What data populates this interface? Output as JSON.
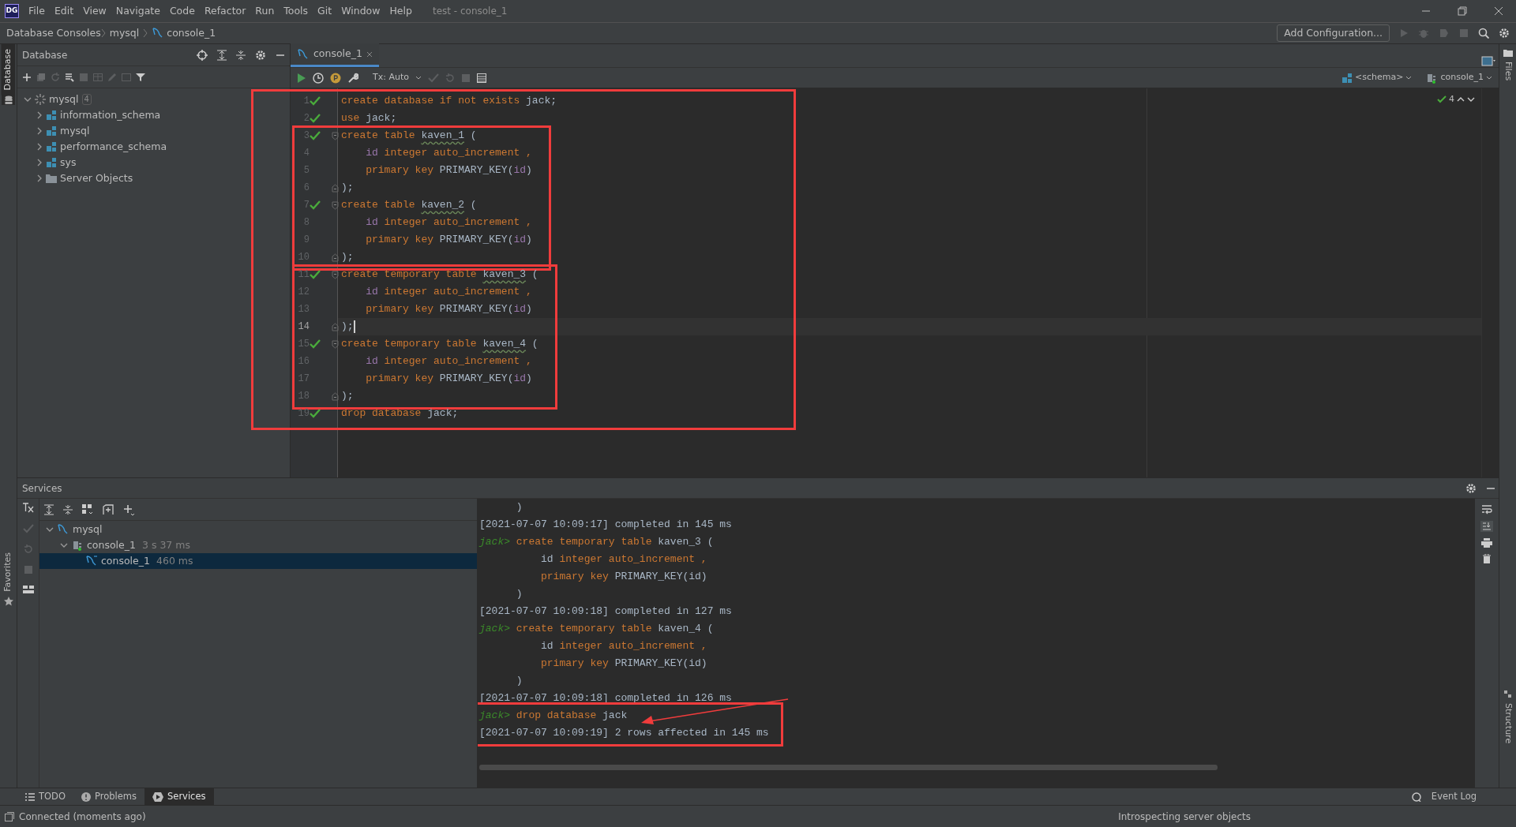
{
  "title_bar": {
    "logo": "DG",
    "menu": [
      "File",
      "Edit",
      "View",
      "Navigate",
      "Code",
      "Refactor",
      "Run",
      "Tools",
      "Git",
      "Window",
      "Help"
    ],
    "title": "test - console_1"
  },
  "nav_bar": {
    "breadcrumbs": [
      "Database Consoles",
      "mysql",
      "console_1"
    ],
    "run_config": "Add Configuration..."
  },
  "left_stripe": {
    "top_label": "Database",
    "bottom_label": "Favorites"
  },
  "right_stripe": {
    "top_label": "Files",
    "bottom_label": "Structure"
  },
  "database_panel": {
    "title": "Database",
    "tree": [
      {
        "label": "mysql",
        "badge": "4",
        "kind": "datasource",
        "expanded": true,
        "children": [
          {
            "label": "information_schema",
            "kind": "schema",
            "expanded": false
          },
          {
            "label": "mysql",
            "kind": "schema",
            "expanded": false
          },
          {
            "label": "performance_schema",
            "kind": "schema",
            "expanded": false
          },
          {
            "label": "sys",
            "kind": "schema",
            "expanded": false
          },
          {
            "label": "Server Objects",
            "kind": "folder",
            "expanded": false
          }
        ]
      }
    ]
  },
  "editor": {
    "tab": {
      "label": "console_1",
      "selected": true
    },
    "tx_mode": "Tx: Auto",
    "schema": "<schema>",
    "session": "console_1",
    "check_count": "4",
    "framed": true,
    "blocks": [
      {
        "framed": false,
        "lines": [
          {
            "number": "1",
            "check": true,
            "current": false,
            "tokens": [
              {
                "kind": "kw",
                "text": "create database if not exists"
              },
              {
                "kind": "plain",
                "text": " jack;"
              }
            ]
          },
          {
            "number": "2",
            "check": true,
            "current": false,
            "tokens": [
              {
                "kind": "kw",
                "text": "use"
              },
              {
                "kind": "plain",
                "text": " jack;"
              }
            ]
          }
        ]
      },
      {
        "framed": true,
        "lines": [
          {
            "number": "3",
            "check": true,
            "current": false,
            "fold": {
              "kind": "start"
            },
            "tokens": [
              {
                "kind": "kw",
                "text": "create table "
              },
              {
                "kind": "ident",
                "text": "kaven_1"
              },
              {
                "kind": "plain",
                "text": " ("
              }
            ]
          },
          {
            "number": "4",
            "check": false,
            "current": false,
            "tokens": [
              {
                "kind": "col",
                "text": "    id"
              },
              {
                "kind": "kw",
                "text": " integer auto_increment ,"
              }
            ]
          },
          {
            "number": "5",
            "check": false,
            "current": false,
            "tokens": [
              {
                "kind": "kw",
                "text": "    primary key"
              },
              {
                "kind": "plain",
                "text": " PRIMARY_KEY("
              },
              {
                "kind": "col",
                "text": "id"
              },
              {
                "kind": "plain",
                "text": ")"
              }
            ]
          },
          {
            "number": "6",
            "check": false,
            "current": false,
            "fold": {
              "kind": "end"
            },
            "tokens": [
              {
                "kind": "plain",
                "text": ");"
              }
            ]
          },
          {
            "number": "7",
            "check": true,
            "current": false,
            "fold": {
              "kind": "start"
            },
            "tokens": [
              {
                "kind": "kw",
                "text": "create table "
              },
              {
                "kind": "ident",
                "text": "kaven_2"
              },
              {
                "kind": "plain",
                "text": " ("
              }
            ]
          },
          {
            "number": "8",
            "check": false,
            "current": false,
            "tokens": [
              {
                "kind": "col",
                "text": "    id"
              },
              {
                "kind": "kw",
                "text": " integer auto_increment ,"
              }
            ]
          },
          {
            "number": "9",
            "check": false,
            "current": false,
            "tokens": [
              {
                "kind": "kw",
                "text": "    primary key"
              },
              {
                "kind": "plain",
                "text": " PRIMARY_KEY("
              },
              {
                "kind": "col",
                "text": "id"
              },
              {
                "kind": "plain",
                "text": ")"
              }
            ]
          },
          {
            "number": "10",
            "check": false,
            "current": false,
            "fold": {
              "kind": "end"
            },
            "tokens": [
              {
                "kind": "plain",
                "text": ");"
              }
            ]
          }
        ]
      },
      {
        "framed": true,
        "lines": [
          {
            "number": "11",
            "check": true,
            "current": false,
            "fold": {
              "kind": "start"
            },
            "tokens": [
              {
                "kind": "kw",
                "text": "create temporary table "
              },
              {
                "kind": "ident",
                "text": "kaven_3"
              },
              {
                "kind": "plain",
                "text": " ("
              }
            ]
          },
          {
            "number": "12",
            "check": false,
            "current": false,
            "tokens": [
              {
                "kind": "col",
                "text": "    id"
              },
              {
                "kind": "kw",
                "text": " integer auto_increment ,"
              }
            ]
          },
          {
            "number": "13",
            "check": false,
            "current": false,
            "tokens": [
              {
                "kind": "kw",
                "text": "    primary key"
              },
              {
                "kind": "plain",
                "text": " PRIMARY_KEY("
              },
              {
                "kind": "col",
                "text": "id"
              },
              {
                "kind": "plain",
                "text": ")"
              }
            ]
          },
          {
            "number": "14",
            "check": false,
            "current": true,
            "fold": {
              "kind": "end"
            },
            "tokens": [
              {
                "kind": "plain",
                "text": ");"
              }
            ]
          },
          {
            "number": "15",
            "check": true,
            "current": false,
            "fold": {
              "kind": "start"
            },
            "tokens": [
              {
                "kind": "kw",
                "text": "create temporary table "
              },
              {
                "kind": "ident",
                "text": "kaven_4"
              },
              {
                "kind": "plain",
                "text": " ("
              }
            ]
          },
          {
            "number": "16",
            "check": false,
            "current": false,
            "tokens": [
              {
                "kind": "col",
                "text": "    id"
              },
              {
                "kind": "kw",
                "text": " integer auto_increment ,"
              }
            ]
          },
          {
            "number": "17",
            "check": false,
            "current": false,
            "tokens": [
              {
                "kind": "kw",
                "text": "    primary key"
              },
              {
                "kind": "plain",
                "text": " PRIMARY_KEY("
              },
              {
                "kind": "col",
                "text": "id"
              },
              {
                "kind": "plain",
                "text": ")"
              }
            ]
          },
          {
            "number": "18",
            "check": false,
            "current": false,
            "fold": {
              "kind": "end"
            },
            "tokens": [
              {
                "kind": "plain",
                "text": ");"
              }
            ]
          }
        ]
      },
      {
        "framed": false,
        "lines": [
          {
            "number": "19",
            "check": true,
            "current": false,
            "tokens": [
              {
                "kind": "kw",
                "text": "drop database"
              },
              {
                "kind": "plain",
                "text": " jack;"
              }
            ]
          }
        ]
      }
    ]
  },
  "services": {
    "title": "Services",
    "tree": [
      {
        "label": "mysql",
        "kind": "datasource",
        "expanded": true,
        "selected": false,
        "children": [
          {
            "label": "console_1",
            "time": "3 s 37 ms",
            "kind": "session",
            "expanded": true,
            "selected": false,
            "children": [
              {
                "label": "console_1",
                "time": "460 ms",
                "kind": "console",
                "selected": true
              }
            ]
          }
        ]
      }
    ],
    "console": {
      "arrow": true,
      "blocks": [
        {
          "framed": false,
          "lines": [
            {
              "tokens": [
                {
                  "kind": "plain",
                  "text": "      )"
                }
              ]
            },
            {
              "tokens": [
                {
                  "kind": "plain",
                  "text": "[2021-07-07 10:09:17] completed in 145 ms"
                }
              ]
            },
            {
              "tokens": [
                {
                  "kind": "prompt",
                  "text": "jack>"
                },
                {
                  "kind": "kw",
                  "text": " create temporary table"
                },
                {
                  "kind": "plain",
                  "text": " kaven_3 ("
                }
              ]
            },
            {
              "tokens": [
                {
                  "kind": "plain",
                  "text": "          id"
                },
                {
                  "kind": "kw",
                  "text": " integer auto_increment ,"
                }
              ]
            },
            {
              "tokens": [
                {
                  "kind": "kw",
                  "text": "          primary key"
                },
                {
                  "kind": "plain",
                  "text": " PRIMARY_KEY(id)"
                }
              ]
            },
            {
              "tokens": [
                {
                  "kind": "plain",
                  "text": "      )"
                }
              ]
            },
            {
              "tokens": [
                {
                  "kind": "plain",
                  "text": "[2021-07-07 10:09:18] completed in 127 ms"
                }
              ]
            },
            {
              "tokens": [
                {
                  "kind": "prompt",
                  "text": "jack>"
                },
                {
                  "kind": "kw",
                  "text": " create temporary table"
                },
                {
                  "kind": "plain",
                  "text": " kaven_4 ("
                }
              ]
            },
            {
              "tokens": [
                {
                  "kind": "plain",
                  "text": "          id"
                },
                {
                  "kind": "kw",
                  "text": " integer auto_increment ,"
                }
              ]
            },
            {
              "tokens": [
                {
                  "kind": "kw",
                  "text": "          primary key"
                },
                {
                  "kind": "plain",
                  "text": " PRIMARY_KEY(id)"
                }
              ]
            },
            {
              "tokens": [
                {
                  "kind": "plain",
                  "text": "      )"
                }
              ]
            },
            {
              "tokens": [
                {
                  "kind": "plain",
                  "text": "[2021-07-07 10:09:18] completed in 126 ms"
                }
              ]
            }
          ]
        },
        {
          "framed": true,
          "lines": [
            {
              "tokens": [
                {
                  "kind": "prompt",
                  "text": "jack>"
                },
                {
                  "kind": "kw",
                  "text": " drop database"
                },
                {
                  "kind": "plain",
                  "text": " jack"
                }
              ]
            },
            {
              "tokens": [
                {
                  "kind": "plain",
                  "text": "[2021-07-07 10:09:19] 2 rows affected in 145 ms"
                }
              ]
            }
          ]
        }
      ]
    }
  },
  "bottom_tabs": [
    {
      "label": "TODO",
      "kind": "todo",
      "selected": false
    },
    {
      "label": "Problems",
      "kind": "problems",
      "selected": false
    },
    {
      "label": "Services",
      "kind": "services",
      "selected": true
    }
  ],
  "event_log": "Event Log",
  "status_bar": {
    "message": "Connected (moments ago)",
    "progress": "Introspecting server objects"
  }
}
